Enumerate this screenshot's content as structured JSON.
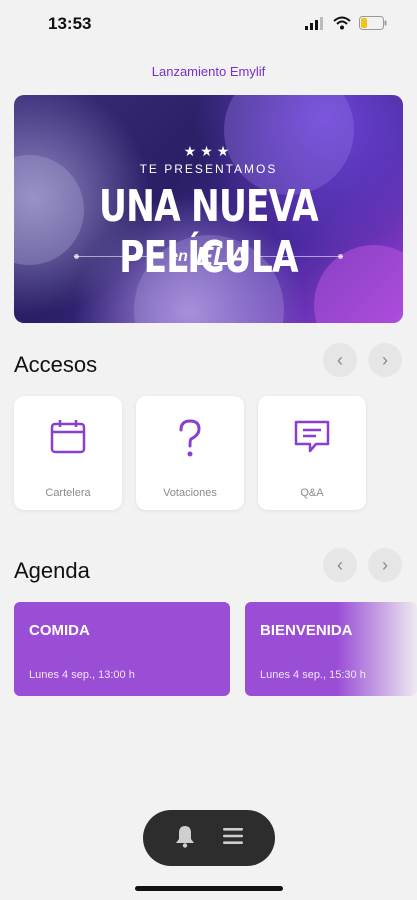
{
  "status": {
    "time": "13:53"
  },
  "app": {
    "title": "Lanzamiento Emylif"
  },
  "banner": {
    "stars": "★★★",
    "pre": "TE PRESENTAMOS",
    "headline": "UNA NUEVA PELÍCULA",
    "en": "en",
    "brand": "ELA"
  },
  "accesos": {
    "title": "Accesos",
    "items": [
      {
        "label": "Cartelera",
        "icon": "calendar-icon"
      },
      {
        "label": "Votaciones",
        "icon": "question-icon"
      },
      {
        "label": "Q&A",
        "icon": "chat-icon"
      }
    ]
  },
  "agenda": {
    "title": "Agenda",
    "items": [
      {
        "title": "COMIDA",
        "date": "Lunes 4 sep., 13:00 h"
      },
      {
        "title": "BIENVENIDA",
        "date": "Lunes 4 sep., 15:30 h"
      }
    ]
  },
  "colors": {
    "accent": "#9a4ed6",
    "title": "#7a2fc9",
    "pill": "#2d2d2d"
  }
}
